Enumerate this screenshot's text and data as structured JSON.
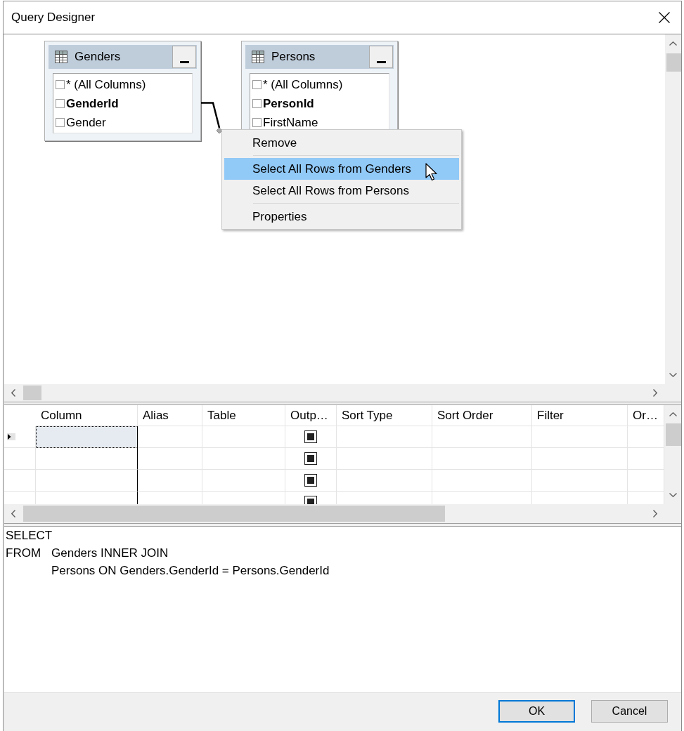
{
  "window": {
    "title": "Query Designer"
  },
  "diagram": {
    "tables": [
      {
        "name": "Genders",
        "columns": [
          {
            "name": "* (All Columns)",
            "key": false,
            "checked": false
          },
          {
            "name": "GenderId",
            "key": true,
            "checked": false
          },
          {
            "name": "Gender",
            "key": false,
            "checked": false
          }
        ]
      },
      {
        "name": "Persons",
        "columns": [
          {
            "name": "* (All Columns)",
            "key": false,
            "checked": false
          },
          {
            "name": "PersonId",
            "key": true,
            "checked": false
          },
          {
            "name": "FirstName",
            "key": false,
            "checked": false
          }
        ]
      }
    ],
    "context_menu": {
      "items": [
        {
          "kind": "item",
          "label": "Remove",
          "selected": false
        },
        {
          "kind": "separator"
        },
        {
          "kind": "item",
          "label": "Select All Rows from Genders",
          "selected": true
        },
        {
          "kind": "item",
          "label": "Select All Rows from Persons",
          "selected": false
        },
        {
          "kind": "separator"
        },
        {
          "kind": "item",
          "label": "Properties",
          "selected": false
        }
      ]
    }
  },
  "grid": {
    "columns": [
      {
        "label": "Column",
        "kind": "text"
      },
      {
        "label": "Alias",
        "kind": "text"
      },
      {
        "label": "Table",
        "kind": "text"
      },
      {
        "label": "Outp…",
        "kind": "checkbox"
      },
      {
        "label": "Sort Type",
        "kind": "text"
      },
      {
        "label": "Sort Order",
        "kind": "text"
      },
      {
        "label": "Filter",
        "kind": "text"
      },
      {
        "label": "Or…",
        "kind": "text"
      }
    ],
    "rows": [
      {
        "current": true,
        "output": true
      },
      {
        "current": false,
        "output": true
      },
      {
        "current": false,
        "output": true
      },
      {
        "current": false,
        "output": true
      }
    ]
  },
  "sql": {
    "lines": [
      {
        "keyword": "SELECT"
      },
      {
        "keyword": "FROM",
        "text": "Genders INNER JOIN"
      },
      {
        "text": "Persons ON Genders.GenderId = Persons.GenderId"
      }
    ]
  },
  "buttons": [
    {
      "label": "OK",
      "default": true
    },
    {
      "label": "Cancel",
      "default": false
    }
  ]
}
